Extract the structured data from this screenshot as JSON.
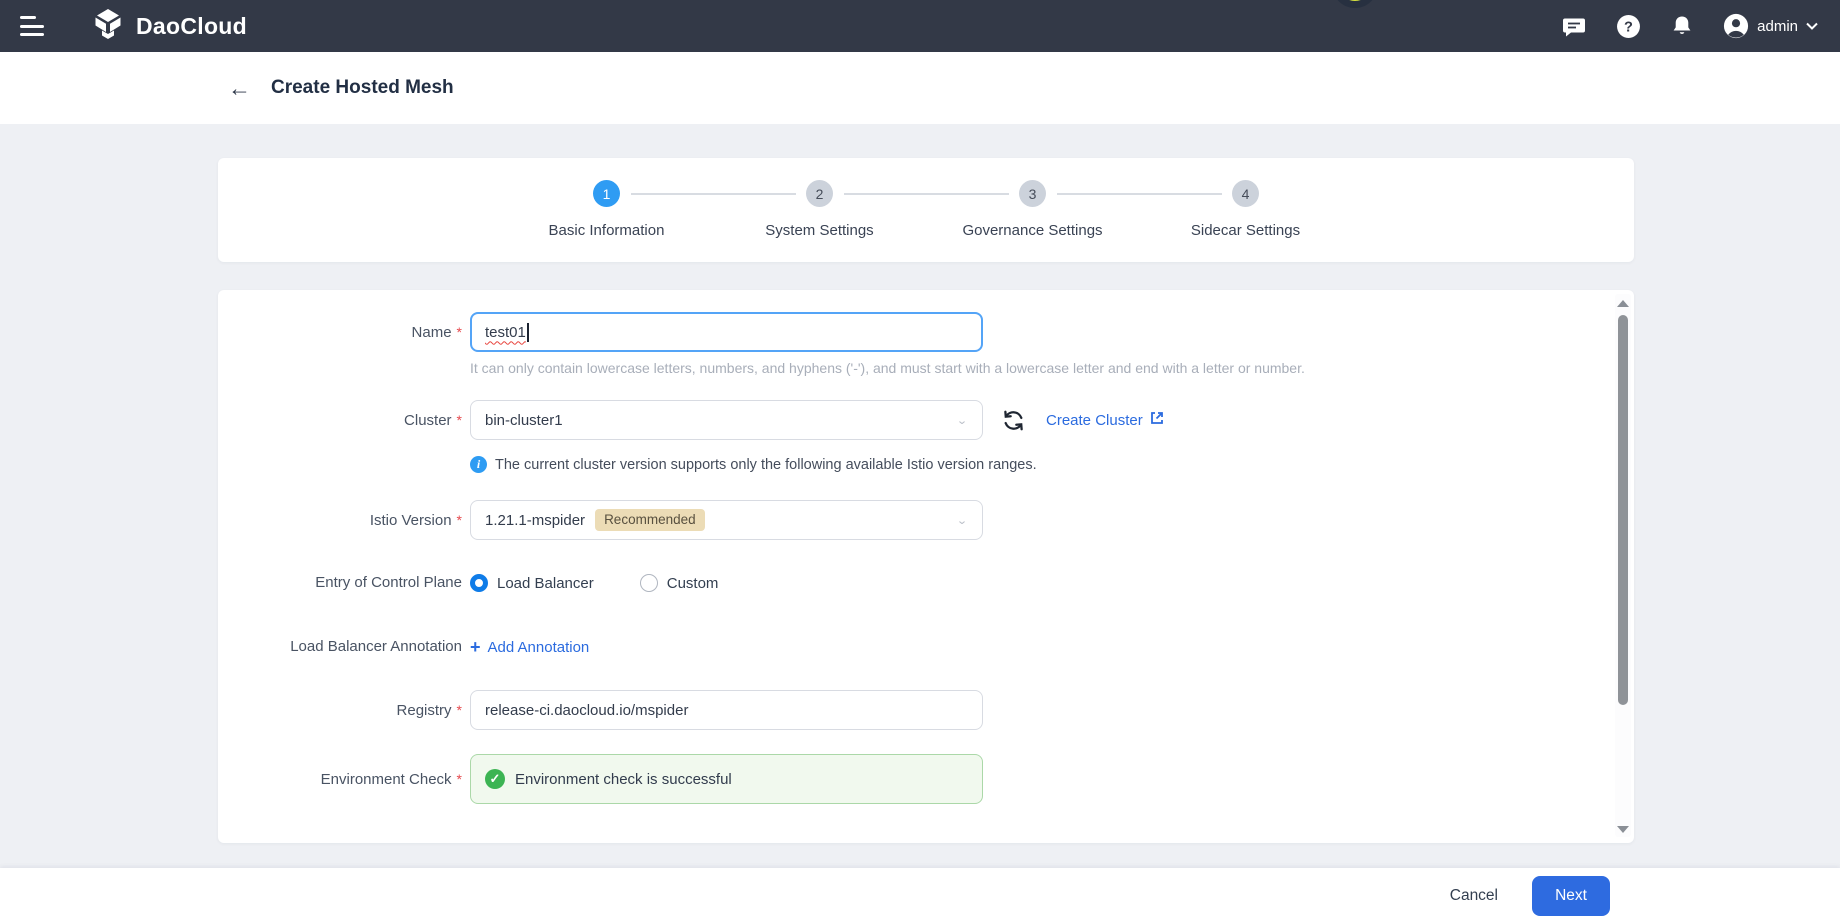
{
  "navbar": {
    "brand": "DaoCloud",
    "user_label": "admin"
  },
  "header": {
    "title": "Create Hosted Mesh"
  },
  "stepper": {
    "steps": [
      {
        "num": "1",
        "label": "Basic Information"
      },
      {
        "num": "2",
        "label": "System Settings"
      },
      {
        "num": "3",
        "label": "Governance Settings"
      },
      {
        "num": "4",
        "label": "Sidecar Settings"
      }
    ]
  },
  "form": {
    "name": {
      "label": "Name",
      "value": "test01",
      "help": "It can only contain lowercase letters, numbers, and hyphens ('-'), and must start with a lowercase letter and end with a letter or number."
    },
    "cluster": {
      "label": "Cluster",
      "value": "bin-cluster1",
      "create_link": "Create Cluster",
      "note": "The current cluster version supports only the following available Istio version ranges."
    },
    "istio": {
      "label": "Istio Version",
      "value": "1.21.1-mspider",
      "badge": "Recommended"
    },
    "entry": {
      "label": "Entry of Control Plane",
      "option1": "Load Balancer",
      "option2": "Custom"
    },
    "annotation": {
      "label": "Load Balancer Annotation",
      "add_label": "Add Annotation"
    },
    "registry": {
      "label": "Registry",
      "value": "release-ci.daocloud.io/mspider"
    },
    "env": {
      "label": "Environment Check",
      "message": "Environment check is successful"
    }
  },
  "footer": {
    "cancel": "Cancel",
    "next": "Next"
  },
  "colors": {
    "navbar_bg": "#333947",
    "step_active_blue": "#2f9cf3",
    "focus_border_blue": "#54a4f7",
    "link_blue": "#2b6bdf",
    "primary_button_blue": "#2e6be0",
    "radio_blue": "#0f7ce8",
    "success_green": "#3cb453",
    "success_bg": "#f1f9ee",
    "badge_bg": "#ecdcb6",
    "required_red": "#e5484d",
    "page_bg": "#eef0f4"
  }
}
